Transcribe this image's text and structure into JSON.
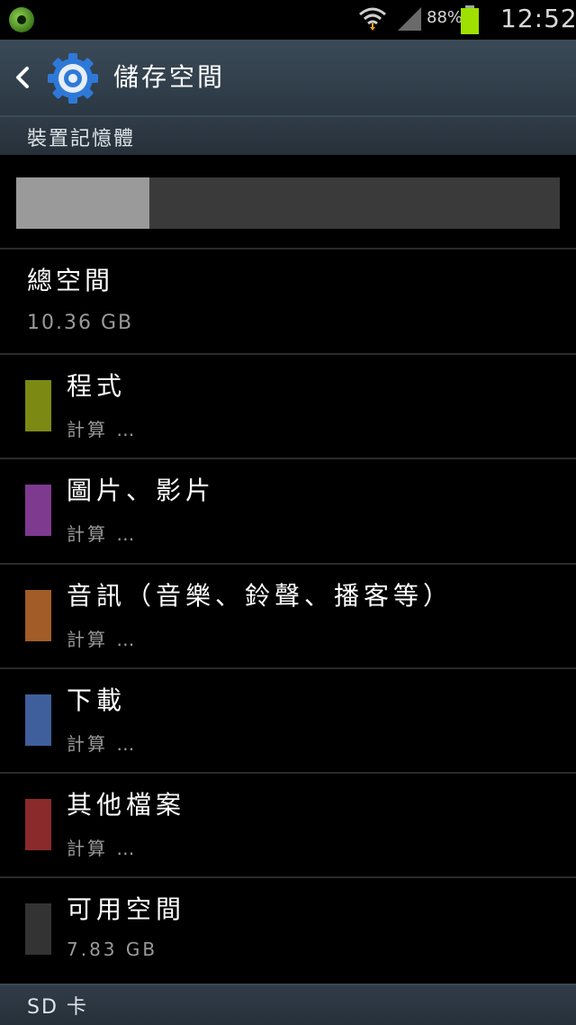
{
  "status_bar": {
    "battery_percent": "88%",
    "battery_level": 0.88,
    "time": "12:52",
    "icons": [
      "app-icon",
      "wifi-icon",
      "signal-icon",
      "battery-icon"
    ],
    "battery_color": "#9ee000"
  },
  "action_bar": {
    "title": "儲存空間",
    "back_icon": "back-icon",
    "app_icon": "gear-icon"
  },
  "sections": {
    "device_memory": "裝置記憶體",
    "sd_card": "SD 卡"
  },
  "usage": {
    "used_fraction": 0.245,
    "used_color": "#9a9a9a",
    "free_color": "#3a3a3a"
  },
  "total": {
    "title": "總空間",
    "value": "10.36 GB"
  },
  "categories": [
    {
      "label": "程式",
      "sub": "計算 …",
      "color": "#7c8a14"
    },
    {
      "label": "圖片、影片",
      "sub": "計算 …",
      "color": "#7e3a8e"
    },
    {
      "label": "音訊（音樂、鈴聲、播客等）",
      "sub": "計算 …",
      "color": "#a25c28"
    },
    {
      "label": "下載",
      "sub": "計算 …",
      "color": "#3f5f9c"
    },
    {
      "label": "其他檔案",
      "sub": "計算 …",
      "color": "#8a2a2a"
    },
    {
      "label": "可用空間",
      "sub": "7.83 GB",
      "color": "#333333"
    }
  ]
}
